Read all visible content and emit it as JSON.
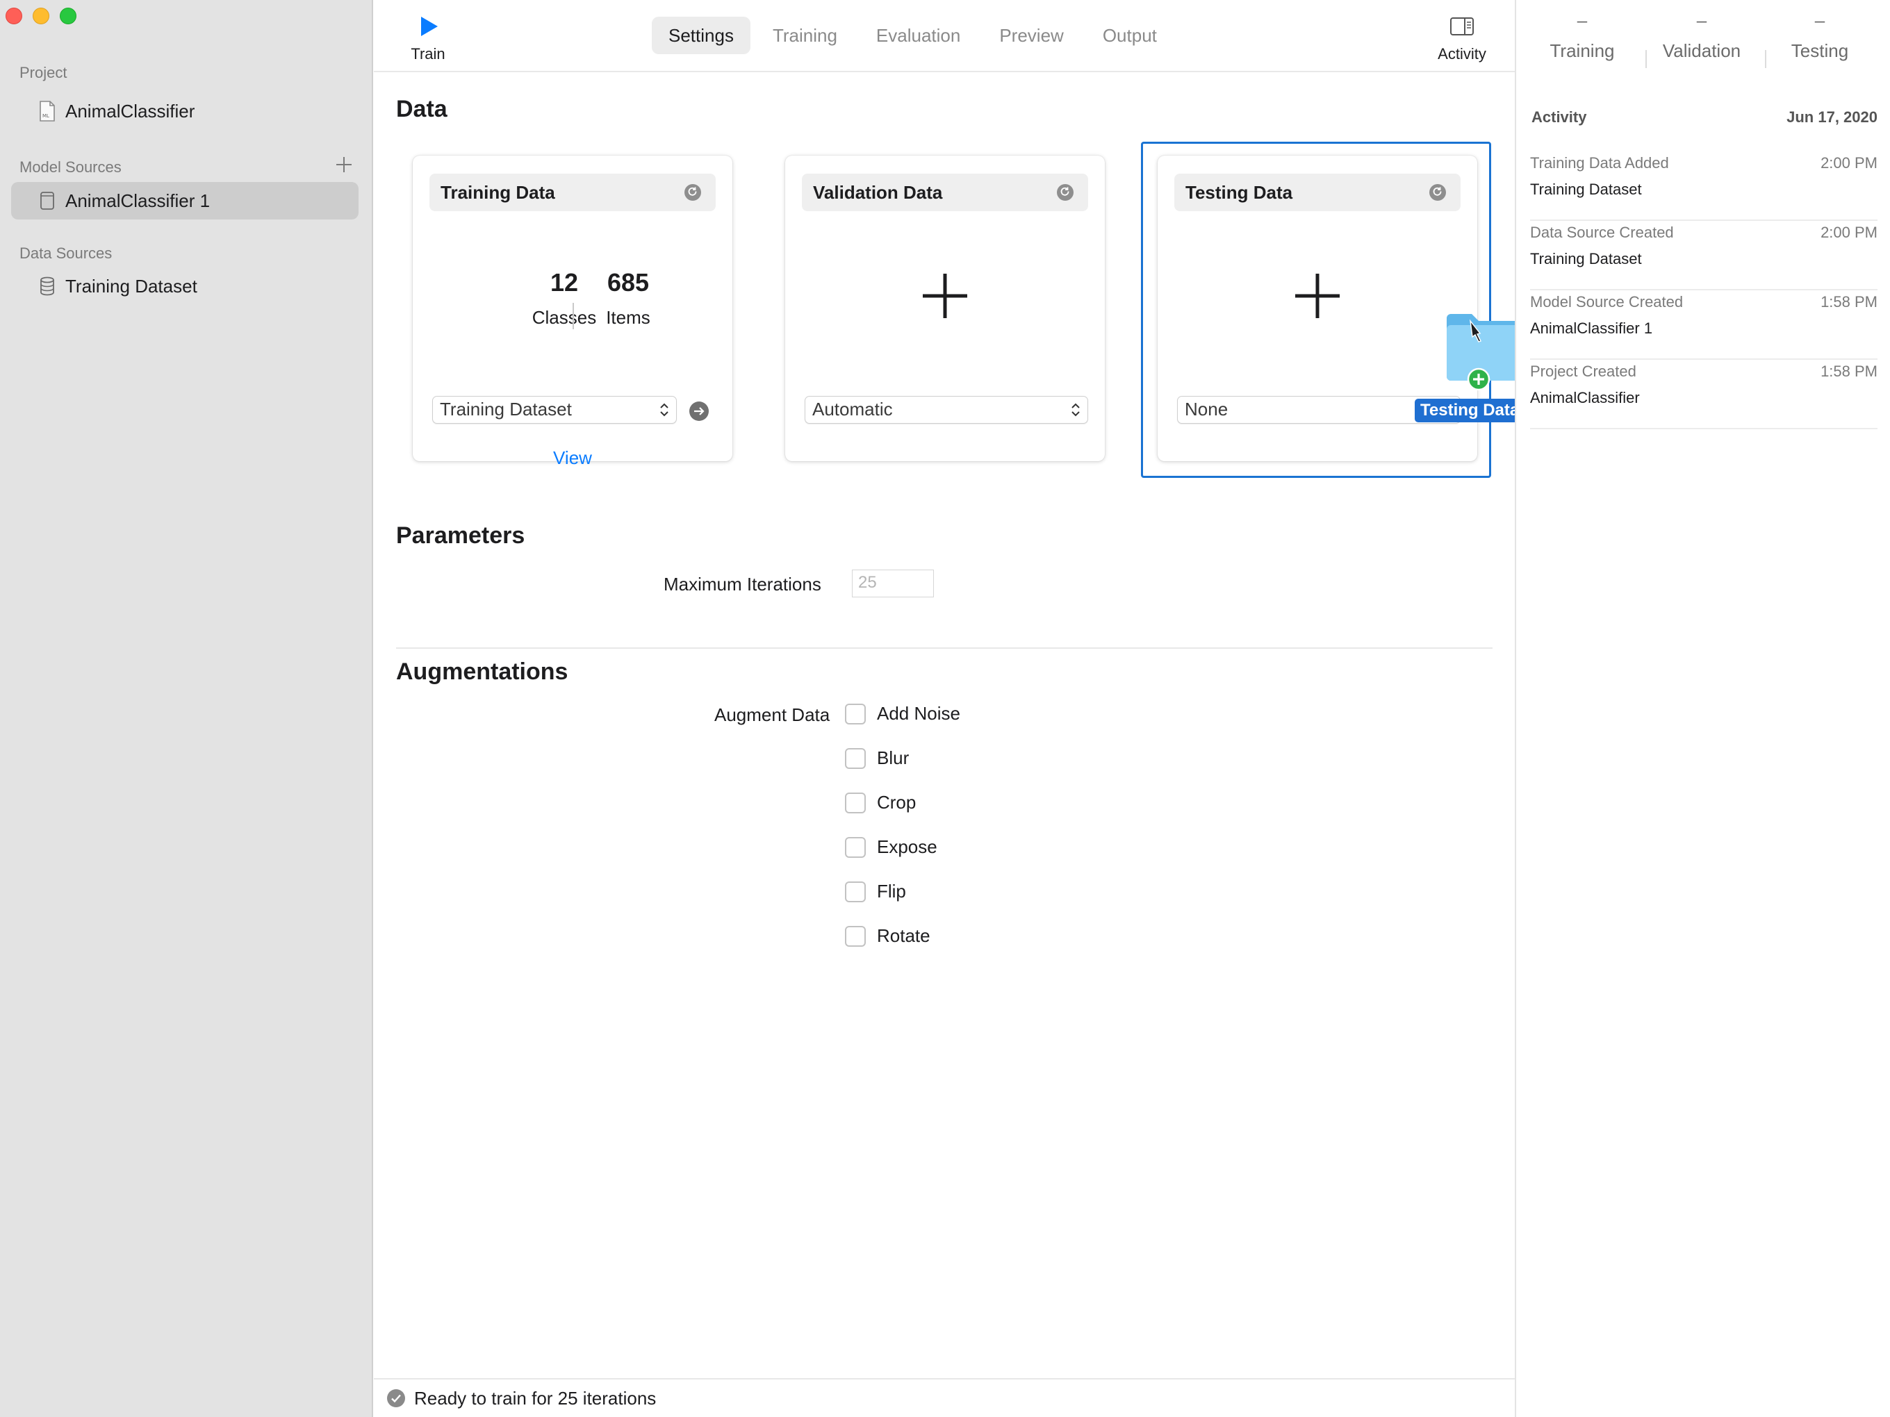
{
  "sidebar": {
    "sections": {
      "project": "Project",
      "model_sources": "Model Sources",
      "data_sources": "Data Sources"
    },
    "project_item": "AnimalClassifier",
    "model_source_item": "AnimalClassifier 1",
    "data_source_item": "Training Dataset"
  },
  "toolbar": {
    "train_label": "Train",
    "tabs": [
      "Settings",
      "Training",
      "Evaluation",
      "Preview",
      "Output"
    ],
    "active_tab": "Settings",
    "activity_label": "Activity"
  },
  "data_section": {
    "title": "Data",
    "training": {
      "title": "Training Data",
      "classes_count": "12",
      "classes_label": "Classes",
      "items_count": "685",
      "items_label": "Items",
      "view_link": "View",
      "selected": "Training Dataset"
    },
    "validation": {
      "title": "Validation Data",
      "selected": "Automatic"
    },
    "testing": {
      "title": "Testing Data",
      "selected": "None"
    },
    "drag_label": "Testing Dataset"
  },
  "parameters": {
    "title": "Parameters",
    "max_iterations_label": "Maximum Iterations",
    "max_iterations_value": "25"
  },
  "augmentations": {
    "title": "Augmentations",
    "label": "Augment Data",
    "options": [
      "Add Noise",
      "Blur",
      "Crop",
      "Expose",
      "Flip",
      "Rotate"
    ]
  },
  "status": {
    "text": "Ready to train for 25 iterations"
  },
  "right_panel": {
    "columns": [
      {
        "value": "–",
        "label": "Training"
      },
      {
        "value": "–",
        "label": "Validation"
      },
      {
        "value": "–",
        "label": "Testing"
      }
    ],
    "activity_header": "Activity",
    "activity_date": "Jun 17, 2020",
    "entries": [
      {
        "title": "Training Data Added",
        "time": "2:00 PM",
        "subtitle": "Training Dataset"
      },
      {
        "title": "Data Source Created",
        "time": "2:00 PM",
        "subtitle": "Training Dataset"
      },
      {
        "title": "Model Source Created",
        "time": "1:58 PM",
        "subtitle": "AnimalClassifier 1"
      },
      {
        "title": "Project Created",
        "time": "1:58 PM",
        "subtitle": "AnimalClassifier"
      }
    ]
  },
  "colors": {
    "accent": "#0a7cff",
    "drop_border": "#1a73d2",
    "sidebar_bg": "#e3e3e3"
  }
}
